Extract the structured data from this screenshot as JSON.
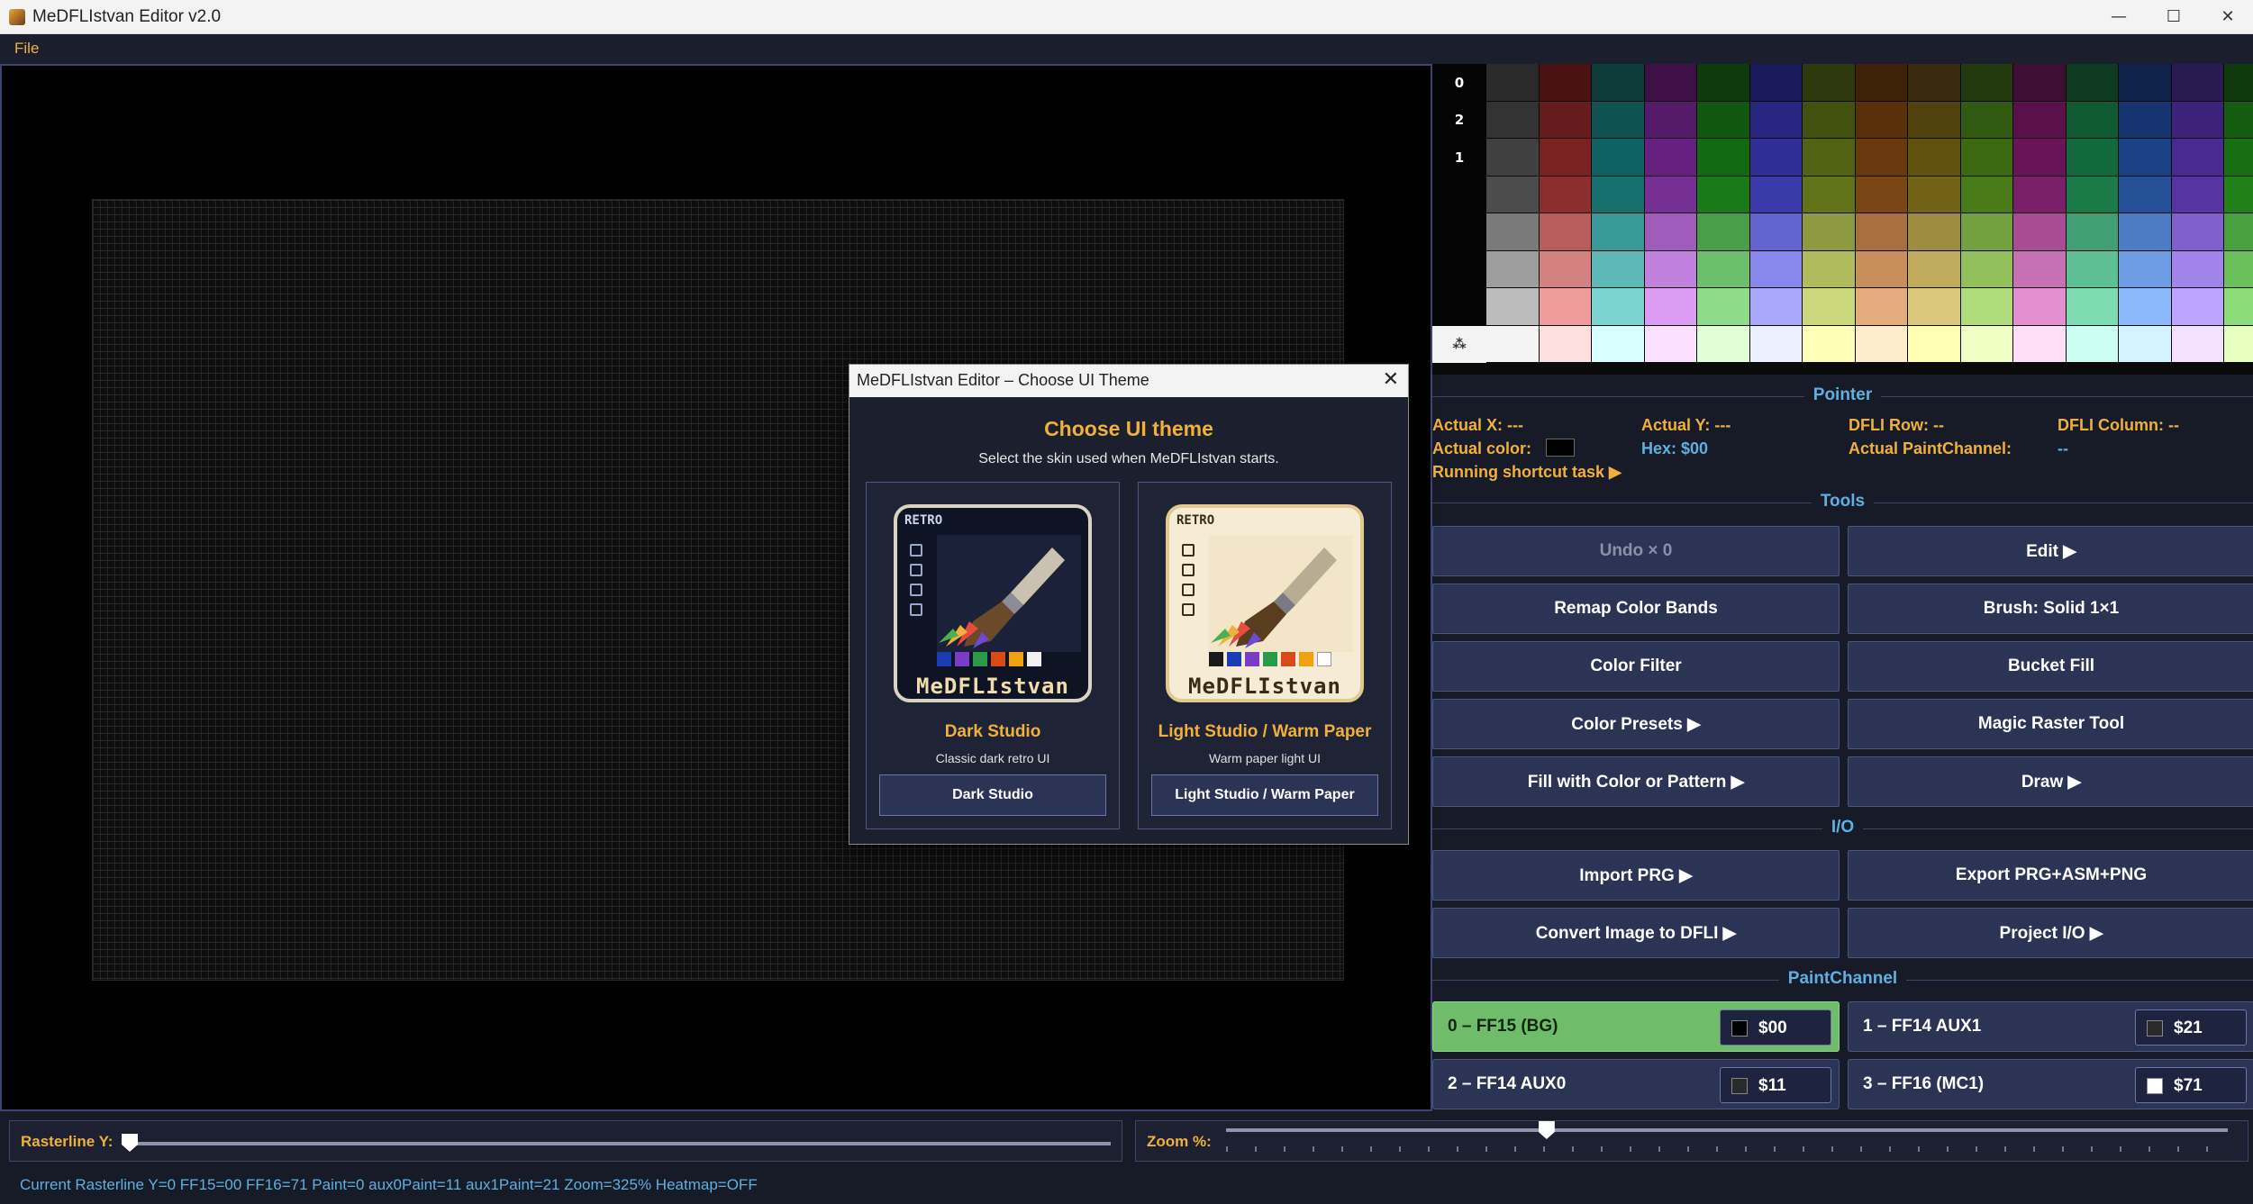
{
  "window": {
    "title": "MeDFLIstvan Editor v2.0",
    "min": "—",
    "max": "☐",
    "close": "✕"
  },
  "menu": {
    "file": "File"
  },
  "palette": {
    "row_labels": [
      "0",
      "",
      "2",
      "1",
      "",
      "",
      "",
      "",
      "⁂"
    ],
    "colors": [
      [
        "#2a2a2a",
        "#4a1212",
        "#0e3c3a",
        "#3e1046",
        "#0e3a0e",
        "#1a1a5a",
        "#2e3a0e",
        "#3e2208",
        "#3a2a0e",
        "#223a0e",
        "#3e0e34",
        "#0e3a22",
        "#0e224a",
        "#2a1a52",
        "#0e3a0e"
      ],
      [
        "#333333",
        "#661c1c",
        "#0e5252",
        "#561a6a",
        "#105810",
        "#262680",
        "#42520e",
        "#5a300a",
        "#52420e",
        "#325a10",
        "#5a104a",
        "#105a32",
        "#163470",
        "#3c2278",
        "#145c10"
      ],
      [
        "#404040",
        "#7a2222",
        "#0e6262",
        "#662080",
        "#126a12",
        "#2e2e96",
        "#526212",
        "#6a3a0e",
        "#625210",
        "#3c6a12",
        "#6a1458",
        "#126a3c",
        "#1c4286",
        "#482a90",
        "#186e12"
      ],
      [
        "#4c4c4c",
        "#8c2e2e",
        "#16706e",
        "#763094",
        "#1a7a1a",
        "#3a3aaa",
        "#627218",
        "#7a4616",
        "#726218",
        "#487a18",
        "#7a2068",
        "#1a7a48",
        "#265098",
        "#5634a2",
        "#22801a"
      ],
      [
        "#7a7a7a",
        "#b85c5c",
        "#3a9a98",
        "#a05cbc",
        "#4a9e4a",
        "#6464d0",
        "#8e9a40",
        "#a8703e",
        "#9e8c40",
        "#74a040",
        "#a84c94",
        "#40a074",
        "#4c7cc4",
        "#8060cc",
        "#4aa03e"
      ],
      [
        "#9e9e9e",
        "#d48080",
        "#5cb8b4",
        "#c080dc",
        "#6cc06c",
        "#8888ec",
        "#b0bc5c",
        "#c88e5c",
        "#c0ac5c",
        "#94c05c",
        "#c870b4",
        "#5cc094",
        "#6c9ce4",
        "#a084ec",
        "#6cc05c"
      ],
      [
        "#bcbcbc",
        "#f09c9c",
        "#7cd4d0",
        "#dc9cf4",
        "#8cdc8c",
        "#a8a8ff",
        "#ccd87c",
        "#e4ac7c",
        "#dcc87c",
        "#b0dc7c",
        "#e490d0",
        "#7cdcb0",
        "#8cb8fc",
        "#bca4ff",
        "#8cdc7c"
      ],
      [
        "#f4f4f4",
        "#ffe0e0",
        "#d8ffff",
        "#fbe0ff",
        "#e0ffd8",
        "#eaf0ff",
        "#ffffb8",
        "#ffeccc",
        "#ffffb4",
        "#f0ffc4",
        "#ffe0f8",
        "#ccfff4",
        "#d4f4ff",
        "#f4e0ff",
        "#e4ffc0"
      ]
    ]
  },
  "pointer": {
    "title": "Pointer",
    "actual_x": "Actual X: ---",
    "actual_y": "Actual Y: ---",
    "dfli_row": "DFLI Row: --",
    "dfli_column": "DFLI Column: --",
    "actual_color": "Actual color:",
    "hex": "Hex: $00",
    "actual_paintchannel": "Actual PaintChannel:",
    "paintchannel_value": "--",
    "running_task": "Running shortcut task ▶"
  },
  "tools": {
    "title": "Tools",
    "buttons": [
      "Undo × 0",
      "Edit ▶",
      "Remap Color Bands",
      "Brush: Solid 1×1",
      "Color Filter",
      "Bucket Fill",
      "Color Presets ▶",
      "Magic Raster Tool",
      "Fill with Color or Pattern ▶",
      "Draw ▶"
    ]
  },
  "io": {
    "title": "I/O",
    "buttons": [
      "Import PRG ▶",
      "Export PRG+ASM+PNG",
      "Convert Image to DFLI ▶",
      "Project I/O ▶"
    ]
  },
  "paintchannel": {
    "title": "PaintChannel",
    "channels": [
      {
        "label": "0 – FF15 (BG)",
        "value": "$00",
        "swatch": "#000000",
        "active": true
      },
      {
        "label": "1 – FF14 AUX1",
        "value": "$21",
        "swatch": "#2a2a2a",
        "active": false
      },
      {
        "label": "2 – FF14 AUX0",
        "value": "$11",
        "swatch": "#2a2a2a",
        "active": false
      },
      {
        "label": "3 – FF16 (MC1)",
        "value": "$71",
        "swatch": "#ffffff",
        "active": false
      }
    ]
  },
  "bottom": {
    "raster_label": "Rasterline Y:",
    "raster_value": 0,
    "zoom_label": "Zoom %:",
    "zoom_fraction": 0.32,
    "status": "Current Rasterline Y=0  FF15=00  FF16=71  Paint=0  aux0Paint=11  aux1Paint=21  Zoom=325%  Heatmap=OFF"
  },
  "dialog": {
    "title": "MeDFLIstvan Editor – Choose UI Theme",
    "close": "✕",
    "heading": "Choose UI theme",
    "subtitle": "Select the skin used when MeDFLIstvan starts.",
    "themes": [
      {
        "logo_tag": "RETRO",
        "logo_name": "MeDFLIstvan",
        "name": "Dark Studio",
        "desc": "Classic dark retro UI",
        "button": "Dark Studio"
      },
      {
        "logo_tag": "RETRO",
        "logo_name": "MeDFLIstvan",
        "name": "Light Studio / Warm Paper",
        "desc": "Warm paper light UI",
        "button": "Light Studio / Warm Paper"
      }
    ]
  },
  "colors": {
    "accent": "#f0b13c",
    "info": "#5fb0e0",
    "active_channel": "#6fbc6a",
    "button_bg": "#2c3456"
  }
}
